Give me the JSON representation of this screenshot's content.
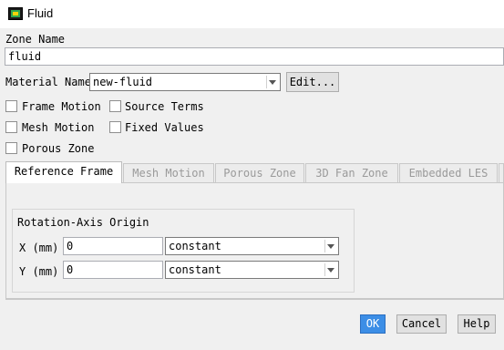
{
  "window": {
    "title": "Fluid",
    "icon": "fluent-app-icon"
  },
  "zone": {
    "label": "Zone Name",
    "value": "fluid"
  },
  "material": {
    "label": "Material Name",
    "value": "new-fluid",
    "edit_label": "Edit..."
  },
  "options": {
    "frame_motion": "Frame Motion",
    "source_terms": "Source Terms",
    "mesh_motion": "Mesh Motion",
    "fixed_values": "Fixed Values",
    "porous_zone": "Porous Zone"
  },
  "tabs": [
    "Reference Frame",
    "Mesh Motion",
    "Porous Zone",
    "3D Fan Zone",
    "Embedded LES"
  ],
  "rotation": {
    "group_title": "Rotation-Axis Origin",
    "x": {
      "label": "X (mm)",
      "value": "0",
      "method": "constant"
    },
    "y": {
      "label": "Y (mm)",
      "value": "0",
      "method": "constant"
    }
  },
  "buttons": {
    "ok": "OK",
    "cancel": "Cancel",
    "help": "Help"
  },
  "colors": {
    "accent": "#3c8ee6",
    "background": "#f0f0f0"
  }
}
